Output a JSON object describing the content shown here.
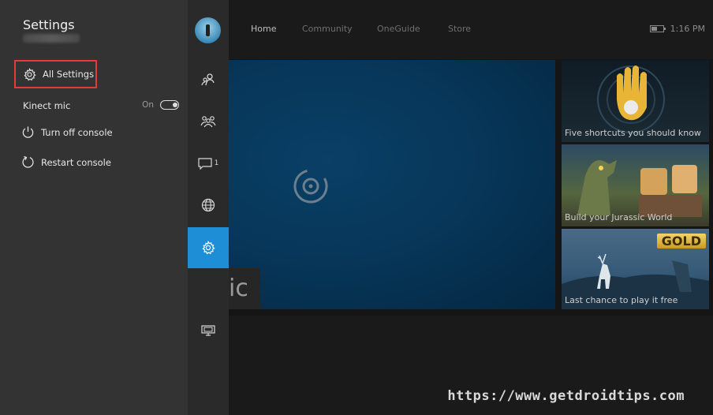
{
  "dashboard": {
    "tabs": [
      {
        "label": "Home",
        "active": true
      },
      {
        "label": "Community",
        "active": false
      },
      {
        "label": "OneGuide",
        "active": false
      },
      {
        "label": "Store",
        "active": false
      }
    ],
    "time": "1:16 PM",
    "hero_label": "ic",
    "tiles": [
      {
        "caption": "Five shortcuts you should know"
      },
      {
        "caption": "Build your Jurassic World"
      },
      {
        "caption": "Last chance to play it free",
        "badge": "GOLD"
      }
    ],
    "watermark": "https://www.getdroidtips.com"
  },
  "rail": {
    "message_count": "1",
    "items": [
      "avatar",
      "friends-icon",
      "party-icon",
      "messages-icon",
      "globe-icon",
      "gear-icon",
      "tv-icon"
    ],
    "selected": "gear-icon",
    "accent": "#1e8fd6"
  },
  "settings_panel": {
    "title": "Settings",
    "items": {
      "all_settings": "All Settings",
      "kinect_mic": "Kinect mic",
      "kinect_state": "On",
      "turn_off": "Turn off console",
      "restart": "Restart console"
    },
    "highlight_color": "#e33a3a"
  }
}
